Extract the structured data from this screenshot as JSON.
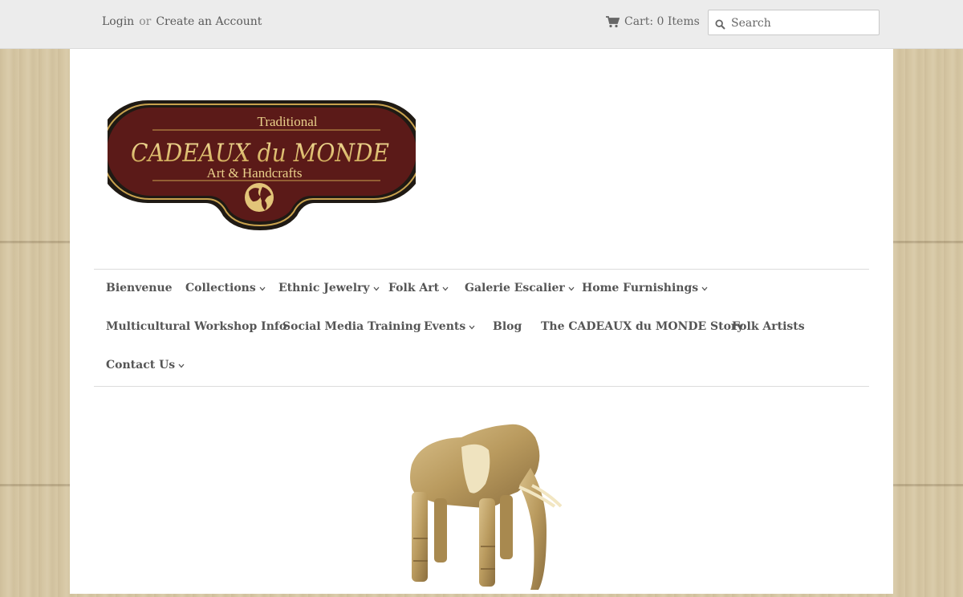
{
  "topbar": {
    "login_label": "Login",
    "or_label": "or",
    "create_account_label": "Create an Account",
    "cart_label": "Cart: 0 Items",
    "search_placeholder": "Search"
  },
  "logo": {
    "line1": "Traditional",
    "line2": "CADEAUX du MONDE",
    "line3": "Art & Handcrafts"
  },
  "nav": {
    "items": [
      {
        "label": "Bienvenue",
        "dropdown": false
      },
      {
        "label": "Collections",
        "dropdown": true
      },
      {
        "label": "Ethnic Jewelry",
        "dropdown": true
      },
      {
        "label": "Folk Art",
        "dropdown": true
      },
      {
        "label": "Galerie Escalier",
        "dropdown": true
      },
      {
        "label": "Home Furnishings",
        "dropdown": true
      },
      {
        "label": "Multicultural Workshop Info",
        "dropdown": false
      },
      {
        "label": "Social Media Training",
        "dropdown": false
      },
      {
        "label": "Events",
        "dropdown": true
      },
      {
        "label": "Blog",
        "dropdown": false
      },
      {
        "label": "The CADEAUX du MONDE Story",
        "dropdown": false
      },
      {
        "label": "Folk Artists",
        "dropdown": false
      },
      {
        "label": "Contact Us",
        "dropdown": true
      }
    ]
  },
  "colors": {
    "logo_background": "#5b1a18",
    "logo_gold": "#e9d08a",
    "topbar_bg": "#ececec",
    "text": "#555555"
  },
  "icons": {
    "cart": "cart-icon",
    "search": "search-icon",
    "dropdown": "chevron-down-icon"
  }
}
